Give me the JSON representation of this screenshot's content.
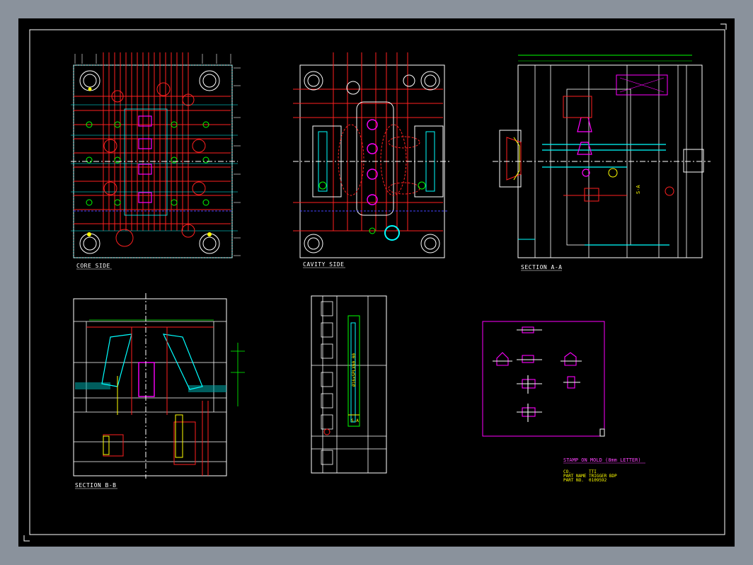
{
  "views": {
    "core_side": "CORE SIDE",
    "cavity_side": "CAVITY SIDE",
    "section_aa": "SECTION A-A",
    "section_bb": "SECTION B-B"
  },
  "stamp": {
    "title": "STAMP ON MOLD (8mm LETTER)"
  },
  "info": {
    "co_label": "CO.",
    "co_value": "TTI",
    "part_name_label": "PART NAME",
    "part_name_value": "TRIGGER BDP",
    "part_no_label": "PART NO.",
    "part_no_value": "0109592"
  },
  "colors": {
    "background": "#000000",
    "frame": "#ffffff",
    "dimension": "#00ffff",
    "outline": "#ff0000",
    "part": "#ff00ff",
    "center": "#00ff00",
    "note": "#ffff00",
    "hidden": "#4444ff"
  }
}
